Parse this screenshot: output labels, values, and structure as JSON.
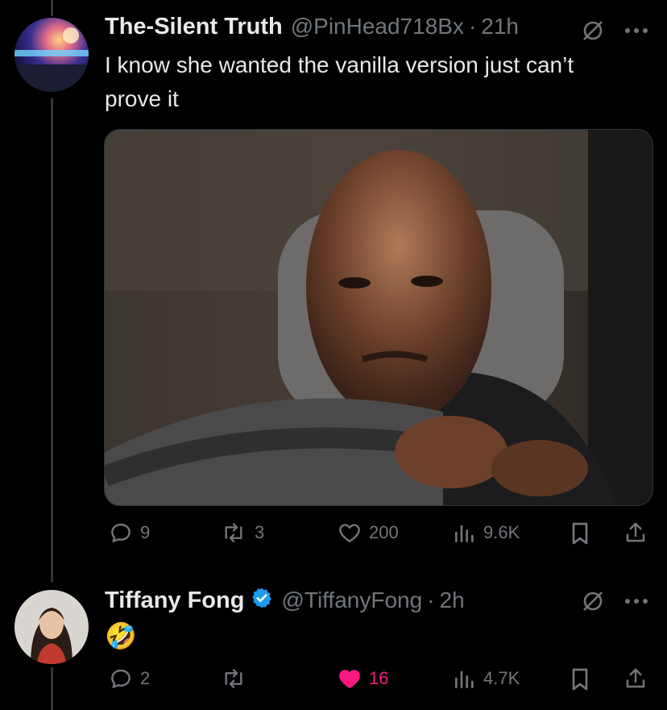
{
  "colors": {
    "background": "#000000",
    "primary_text": "#e7e9ea",
    "secondary_text": "#71767b",
    "like_active": "#f91880",
    "verified": "#1d9bf0"
  },
  "tweets": [
    {
      "name": "The-Silent Truth",
      "handle": "@PinHead718Bx",
      "separator": "·",
      "time": "21h",
      "text": "I know she wanted the vanilla version just can’t prove it",
      "media_description_icon": "gif-still",
      "actions": {
        "replies": "9",
        "reposts": "3",
        "likes": "200",
        "views": "9.6K"
      },
      "liked": false
    },
    {
      "name": "Tiffany Fong",
      "verified": true,
      "handle": "@TiffanyFong",
      "separator": "·",
      "time": "2h",
      "text": "🤣",
      "actions": {
        "replies": "2",
        "reposts": "",
        "likes": "16",
        "views": "4.7K"
      },
      "liked": true
    }
  ]
}
